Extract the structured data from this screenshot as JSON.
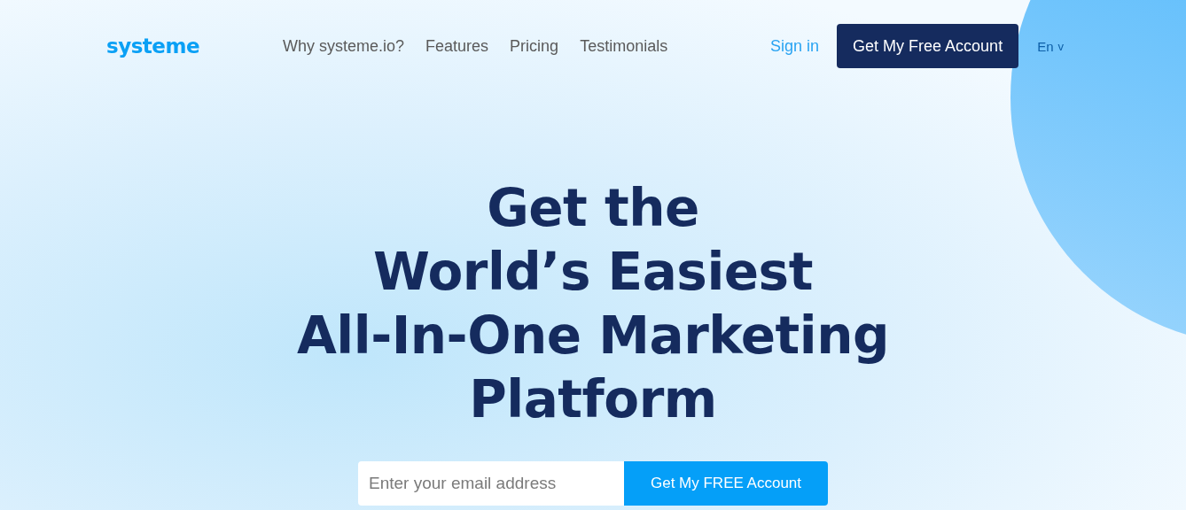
{
  "header": {
    "logo": "systeme",
    "nav": [
      "Why systeme.io?",
      "Features",
      "Pricing",
      "Testimonials"
    ],
    "sign_in": "Sign in",
    "cta": "Get My Free Account",
    "language": "En",
    "language_caret": "v"
  },
  "hero": {
    "headline": [
      "Get the",
      "World’s Easiest",
      "All-In-One Marketing",
      "Platform"
    ],
    "email": {
      "placeholder": "Enter your email address"
    },
    "submit": "Get My FREE Account"
  }
}
